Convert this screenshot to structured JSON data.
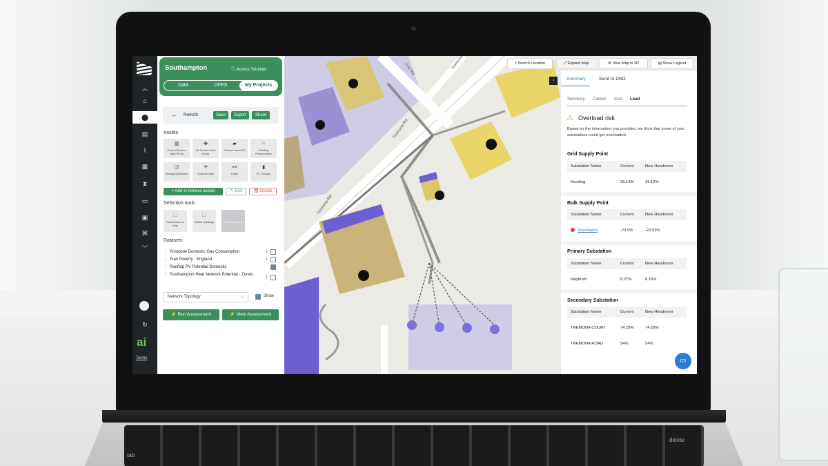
{
  "app": {
    "city": "Southampton",
    "access_tutorials": "Access Tutorials",
    "main_tabs": [
      "Data",
      "DFES",
      "My Projects"
    ],
    "active_main_tab": "My Projects",
    "terms": "Terms",
    "brand_logo": "ai"
  },
  "retrofit": {
    "title": "Retrofit",
    "save": "Save",
    "export": "Export",
    "share": "Share"
  },
  "assets": {
    "heading": "Assets",
    "items": [
      {
        "label": "Ground Source Heat Pump",
        "icon": "heat-pump-icon"
      },
      {
        "label": "Air Source Heat Pump",
        "icon": "fan-icon"
      },
      {
        "label": "Ground mount PV",
        "icon": "solar-panel-icon"
      },
      {
        "label": "Rooftop Photovoltaics",
        "icon": "rooftop-pv-icon"
      },
      {
        "label": "Storage (domestic)",
        "icon": "battery-icon"
      },
      {
        "label": "Onshore wind",
        "icon": "wind-turbine-icon"
      },
      {
        "label": "Cable",
        "icon": "cable-icon"
      },
      {
        "label": "EV Charger",
        "icon": "ev-charger-icon"
      }
    ],
    "add_remove": "Add or remove assets",
    "edit": "Edit",
    "delete": "Delete"
  },
  "selection_tools": {
    "heading": "Selection tools",
    "items": [
      {
        "label": "Select area on map"
      },
      {
        "label": "Select buildings"
      },
      {
        "label": "Building portfolio"
      }
    ]
  },
  "datasets": {
    "heading": "Datasets",
    "items": [
      {
        "label": "Postcode Domestic Gas Consumption",
        "checked": false
      },
      {
        "label": "Fuel Poverty - England",
        "checked": false
      },
      {
        "label": "Rooftop PV Potential Domestic",
        "checked": true
      },
      {
        "label": "Southampton Heat Network Potential - Zones",
        "checked": false
      }
    ],
    "network_select": "Network Topology",
    "show_label": "Show",
    "run_assessment": "Run Assessment",
    "view_assessment": "View Assessment"
  },
  "map": {
    "search_location": "Search Location",
    "expand_map": "Expand Map",
    "view_3d": "View Map in 3D",
    "show_legend": "Show Legend",
    "street_labels": [
      "Tremona Rd",
      "Tremona Rd",
      "Tremona Rd",
      "rine Rd"
    ]
  },
  "right_panel": {
    "tabs": [
      "Summary",
      "Send to DNO"
    ],
    "subtabs": [
      "Summary",
      "Carbon",
      "Cost",
      "Load"
    ],
    "active_subtab": "Load",
    "overload_title": "Overload risk",
    "overload_text": "Based on the information you provided, we think that some of your substations could get overloaded.",
    "columns": [
      "Substation Name",
      "Current",
      "New Headroom"
    ],
    "sections": [
      {
        "title": "Grid Supply Point",
        "rows": [
          {
            "name": "Nursling",
            "current": "39.13%",
            "headroom": "39.12%"
          }
        ]
      },
      {
        "title": "Bulk Supply Point",
        "rows": [
          {
            "name": "Rownhams",
            "current": "-23.5%",
            "headroom": "-23.52%"
          }
        ]
      },
      {
        "title": "Primary Substation",
        "rows": [
          {
            "name": "Maybush",
            "current": "8.27%",
            "headroom": "8.15%"
          }
        ]
      },
      {
        "title": "Secondary Substation",
        "rows": [
          {
            "name": "TREMONA COURT",
            "current": "74.29%",
            "headroom": "74.28%"
          },
          {
            "name": "TREMONA ROAD",
            "current": "54%",
            "headroom": "54%"
          }
        ]
      }
    ]
  },
  "keyboard": {
    "delete_key": "delete",
    "tab_key": "tab"
  },
  "colors": {
    "brand_green": "#3a8f5d",
    "accent_blue": "#2a7cc6",
    "building_yellow": "#e8d66a",
    "building_purple": "#7266d4",
    "warning": "#e8b11a",
    "alert_red": "#e0413e"
  }
}
